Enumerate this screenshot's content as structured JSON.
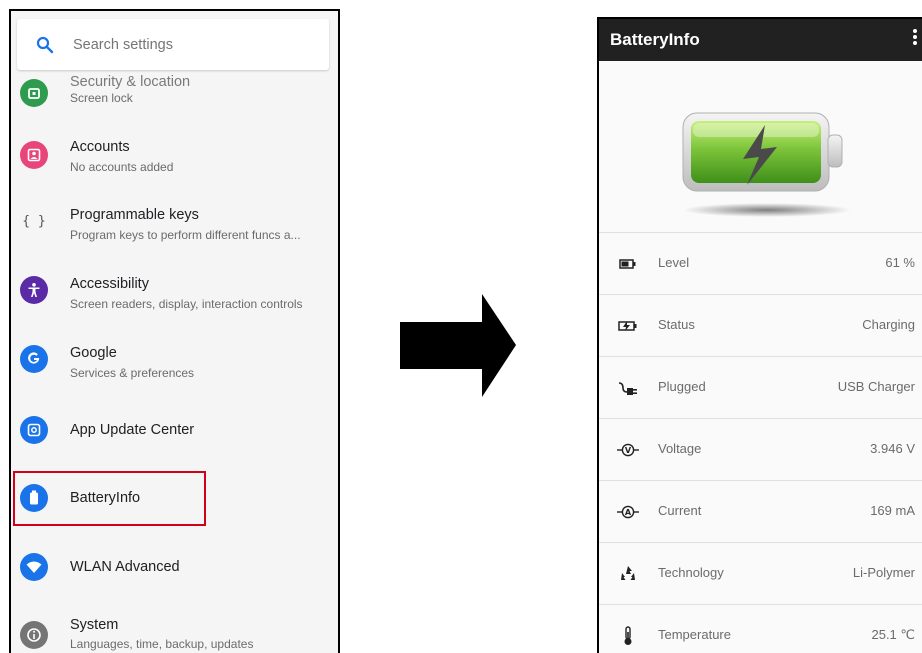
{
  "settings": {
    "search_placeholder": "Search settings",
    "items": [
      {
        "title": "Security & location",
        "subtitle": "Screen lock",
        "icon": "lock-icon",
        "color": "#2e9b4f"
      },
      {
        "title": "Accounts",
        "subtitle": "No accounts added",
        "icon": "account-icon",
        "color": "#e8457a"
      },
      {
        "title": "Programmable keys",
        "subtitle": "Program keys to perform different funcs a...",
        "icon": "braces-icon",
        "color": "#555555"
      },
      {
        "title": "Accessibility",
        "subtitle": "Screen readers, display, interaction controls",
        "icon": "accessibility-icon",
        "color": "#5b2aa6"
      },
      {
        "title": "Google",
        "subtitle": "Services & preferences",
        "icon": "google-icon",
        "color": "#1a73e8"
      },
      {
        "title": "App Update Center",
        "subtitle": "",
        "icon": "app-update-icon",
        "color": "#1a73e8"
      },
      {
        "title": "BatteryInfo",
        "subtitle": "",
        "icon": "battery-icon",
        "color": "#1a73e8"
      },
      {
        "title": "WLAN Advanced",
        "subtitle": "",
        "icon": "wifi-icon",
        "color": "#1a73e8"
      },
      {
        "title": "System",
        "subtitle": "Languages, time, backup, updates",
        "icon": "info-icon",
        "color": "#757575"
      }
    ]
  },
  "battery_app": {
    "title": "BatteryInfo",
    "rows": [
      {
        "label": "Level",
        "value": "61 %",
        "icon": "battery-level-icon"
      },
      {
        "label": "Status",
        "value": "Charging",
        "icon": "charging-status-icon"
      },
      {
        "label": "Plugged",
        "value": "USB Charger",
        "icon": "plug-icon"
      },
      {
        "label": "Voltage",
        "value": "3.946 V",
        "icon": "voltage-icon"
      },
      {
        "label": "Current",
        "value": "169 mA",
        "icon": "current-icon"
      },
      {
        "label": "Technology",
        "value": "Li-Polymer",
        "icon": "recycle-icon"
      },
      {
        "label": "Temperature",
        "value": "25.1 ℃",
        "icon": "thermometer-icon"
      }
    ]
  }
}
